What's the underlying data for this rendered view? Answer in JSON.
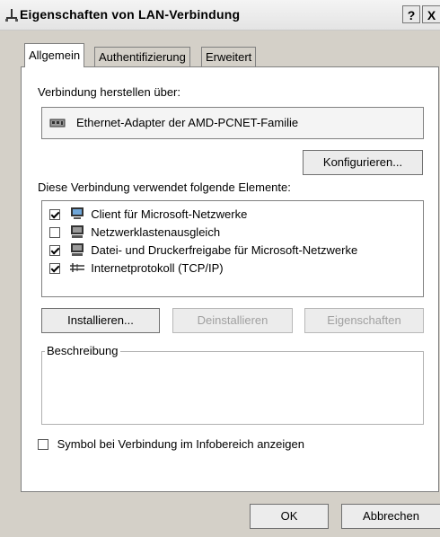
{
  "window": {
    "title": "Eigenschaften von LAN-Verbindung",
    "help_label": "?",
    "close_label": "X"
  },
  "tabs": [
    {
      "label": "Allgemein",
      "active": true
    },
    {
      "label": "Authentifizierung",
      "active": false
    },
    {
      "label": "Erweitert",
      "active": false
    }
  ],
  "connect": {
    "label": "Verbindung herstellen über:",
    "adapter": "Ethernet-Adapter der AMD-PCNET-Familie",
    "configure_label": "Konfigurieren..."
  },
  "components": {
    "label": "Diese Verbindung verwendet folgende Elemente:",
    "items": [
      {
        "label": "Client für Microsoft-Netzwerke",
        "checked": true,
        "icon": "network-client-icon"
      },
      {
        "label": "Netzwerklastenausgleich",
        "checked": false,
        "icon": "network-service-icon"
      },
      {
        "label": "Datei- und Druckerfreigabe für Microsoft-Netzwerke",
        "checked": true,
        "icon": "network-service-icon"
      },
      {
        "label": "Internetprotokoll (TCP/IP)",
        "checked": true,
        "icon": "protocol-icon"
      }
    ]
  },
  "buttons": {
    "install": "Installieren...",
    "uninstall": "Deinstallieren",
    "properties": "Eigenschaften"
  },
  "description": {
    "label": "Beschreibung",
    "text": ""
  },
  "tray_option": {
    "label": "Symbol bei Verbindung im Infobereich anzeigen",
    "checked": false
  },
  "footer": {
    "ok": "OK",
    "cancel": "Abbrechen"
  }
}
